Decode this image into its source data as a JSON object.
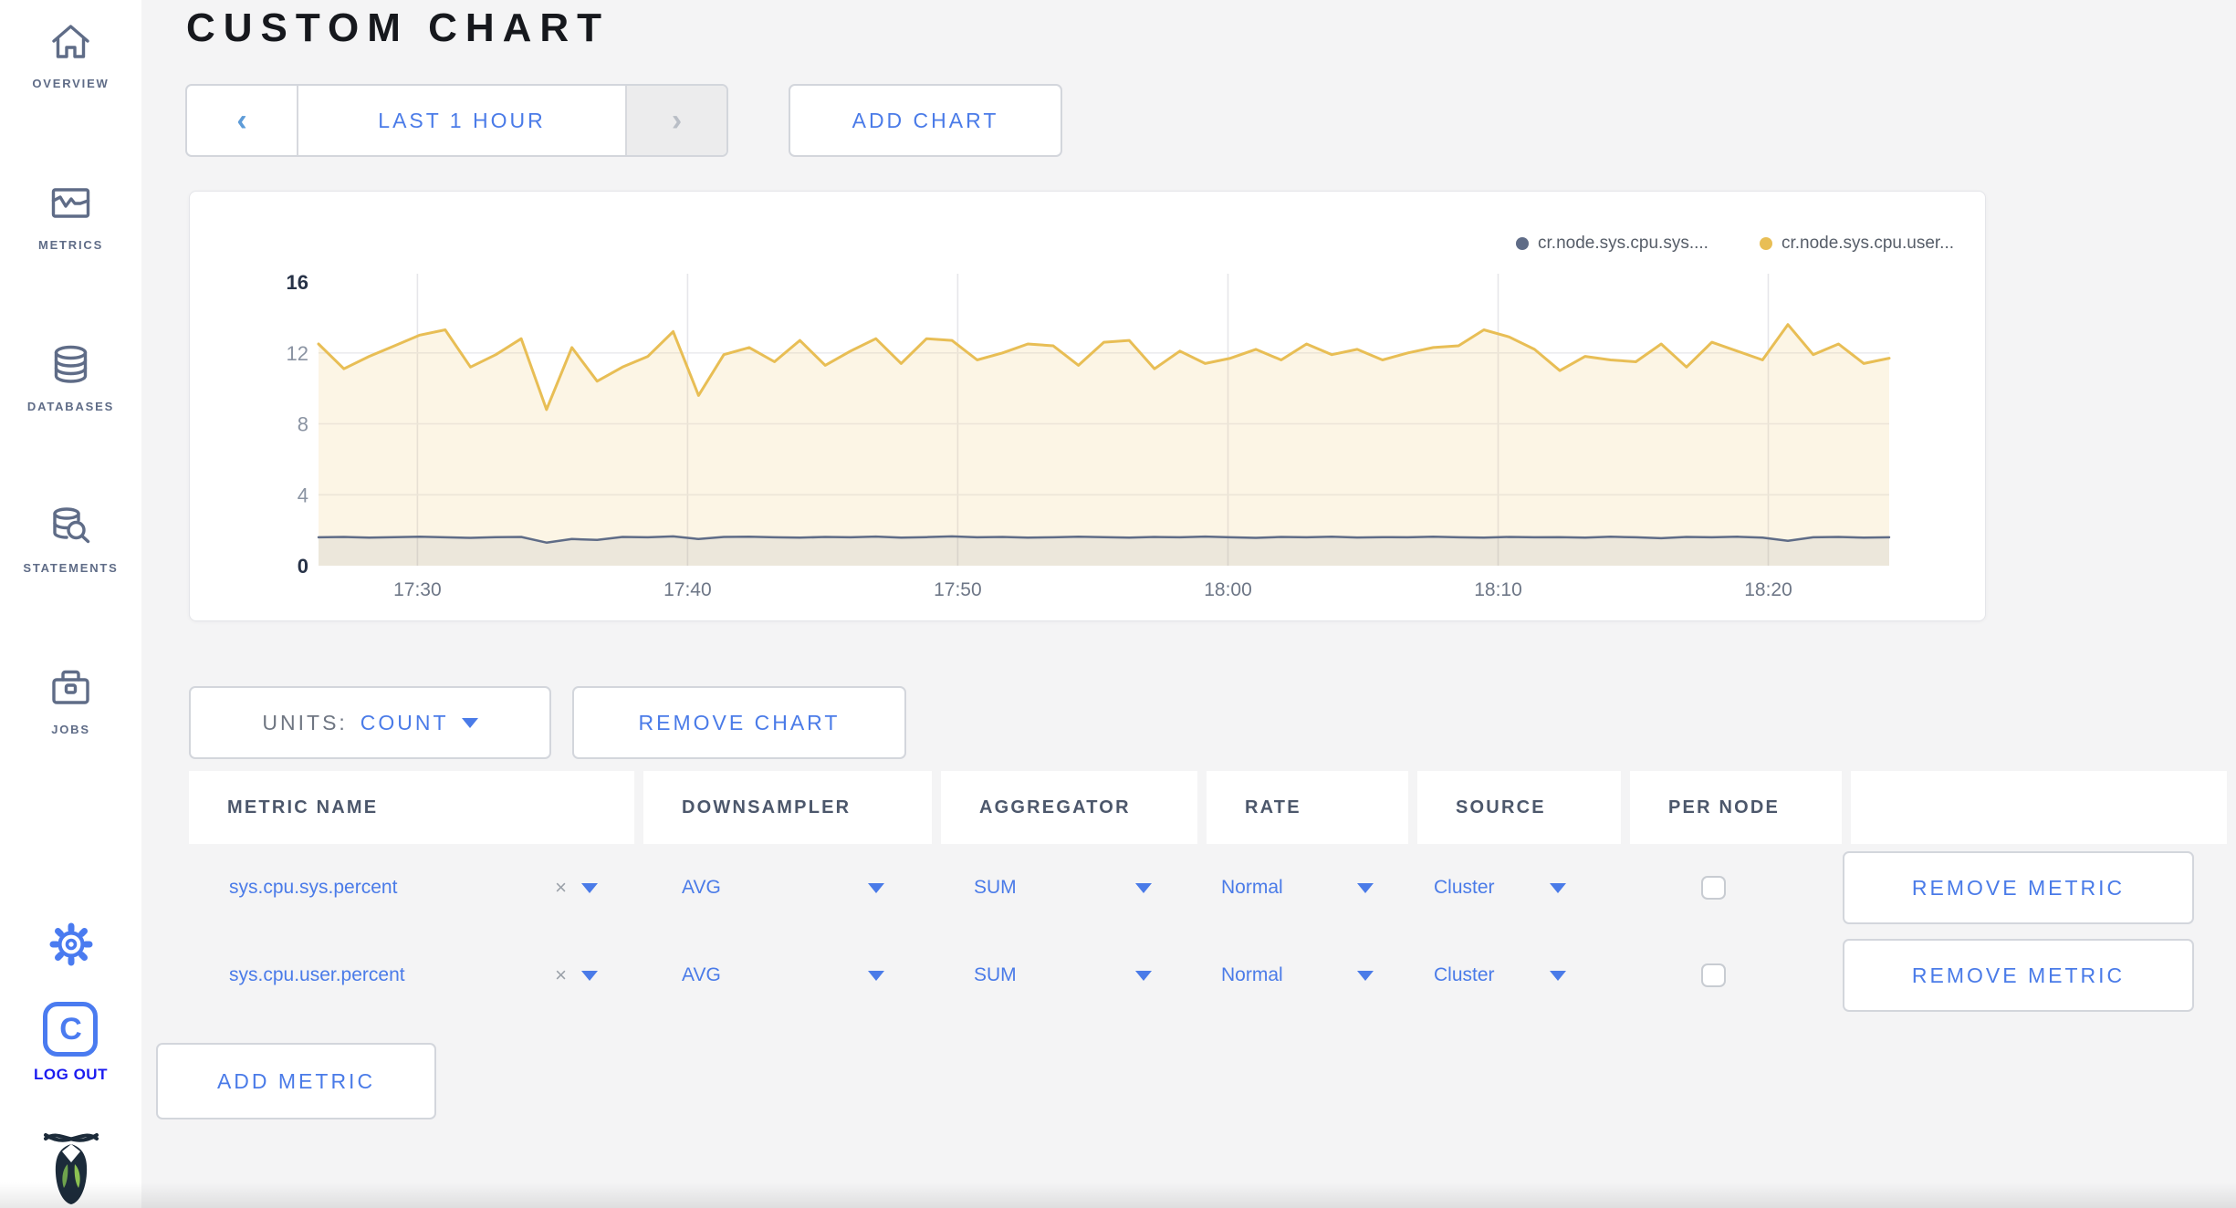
{
  "sidebar": {
    "items": [
      {
        "label": "OVERVIEW",
        "icon": "home-icon"
      },
      {
        "label": "METRICS",
        "icon": "metrics-icon"
      },
      {
        "label": "DATABASES",
        "icon": "databases-icon"
      },
      {
        "label": "STATEMENTS",
        "icon": "statements-icon"
      },
      {
        "label": "JOBS",
        "icon": "jobs-icon"
      }
    ],
    "settings_icon": "gear-icon",
    "logout": {
      "initial": "C",
      "label": "LOG OUT"
    },
    "logo_icon": "cockroach-bug-icon"
  },
  "header": {
    "title": "CUSTOM CHART"
  },
  "timebar": {
    "prev_icon": "chevron-left-icon",
    "range_label": "LAST 1 HOUR",
    "next_icon": "chevron-right-icon",
    "next_disabled": true,
    "add_chart_label": "ADD CHART"
  },
  "chart_data": {
    "type": "line",
    "title": "",
    "legend_position": "top-right",
    "grid": true,
    "ylim": [
      0,
      16
    ],
    "y_ticks": [
      0,
      4,
      8,
      12,
      16
    ],
    "grid_y": [
      4,
      8,
      12
    ],
    "x_ticks": [
      "17:30",
      "17:40",
      "17:50",
      "18:00",
      "18:10",
      "18:20"
    ],
    "x_tick_fracs": [
      0.063,
      0.235,
      0.407,
      0.579,
      0.751,
      0.923
    ],
    "series": [
      {
        "name": "cr.node.sys.cpu.sys....",
        "color": "#5F6C87",
        "fill": "rgba(95,108,135,0.10)",
        "line_width": 2.5,
        "values": [
          1.6,
          1.62,
          1.58,
          1.61,
          1.63,
          1.6,
          1.57,
          1.61,
          1.62,
          1.3,
          1.5,
          1.45,
          1.62,
          1.6,
          1.65,
          1.5,
          1.62,
          1.63,
          1.6,
          1.58,
          1.62,
          1.6,
          1.64,
          1.58,
          1.61,
          1.65,
          1.6,
          1.62,
          1.58,
          1.6,
          1.63,
          1.61,
          1.58,
          1.62,
          1.6,
          1.64,
          1.6,
          1.57,
          1.62,
          1.6,
          1.63,
          1.59,
          1.61,
          1.6,
          1.63,
          1.6,
          1.58,
          1.62,
          1.6,
          1.61,
          1.58,
          1.63,
          1.6,
          1.55,
          1.62,
          1.6,
          1.63,
          1.58,
          1.4,
          1.6,
          1.62,
          1.58,
          1.6
        ]
      },
      {
        "name": "cr.node.sys.cpu.user...",
        "color": "#E8BE55",
        "fill": "rgba(236,200,110,0.18)",
        "line_width": 3,
        "values": [
          12.5,
          11.1,
          11.8,
          12.4,
          13.0,
          13.3,
          11.2,
          11.9,
          12.8,
          8.8,
          12.3,
          10.4,
          11.2,
          11.8,
          13.2,
          9.6,
          11.9,
          12.3,
          11.5,
          12.7,
          11.3,
          12.1,
          12.8,
          11.4,
          12.8,
          12.7,
          11.6,
          12.0,
          12.5,
          12.4,
          11.3,
          12.6,
          12.7,
          11.1,
          12.1,
          11.4,
          11.7,
          12.2,
          11.6,
          12.5,
          11.9,
          12.2,
          11.6,
          12.0,
          12.3,
          12.4,
          13.3,
          12.9,
          12.2,
          11.0,
          11.8,
          11.6,
          11.5,
          12.5,
          11.2,
          12.6,
          12.1,
          11.6,
          13.6,
          11.9,
          12.5,
          11.4,
          11.7
        ]
      }
    ]
  },
  "units": {
    "label": "UNITS:",
    "value": "COUNT"
  },
  "chart_actions": {
    "remove_chart_label": "REMOVE CHART",
    "add_metric_label": "ADD METRIC"
  },
  "table": {
    "headers": [
      "METRIC NAME",
      "DOWNSAMPLER",
      "AGGREGATOR",
      "RATE",
      "SOURCE",
      "PER NODE",
      ""
    ]
  },
  "metrics": {
    "rows": [
      {
        "name": "sys.cpu.sys.percent",
        "remove": "×",
        "downsampler": "AVG",
        "aggregator": "SUM",
        "rate": "Normal",
        "source": "Cluster",
        "per_node_checked": false,
        "remove_label": "REMOVE METRIC"
      },
      {
        "name": "sys.cpu.user.percent",
        "remove": "×",
        "downsampler": "AVG",
        "aggregator": "SUM",
        "rate": "Normal",
        "source": "Cluster",
        "per_node_checked": false,
        "remove_label": "REMOVE METRIC"
      }
    ]
  }
}
